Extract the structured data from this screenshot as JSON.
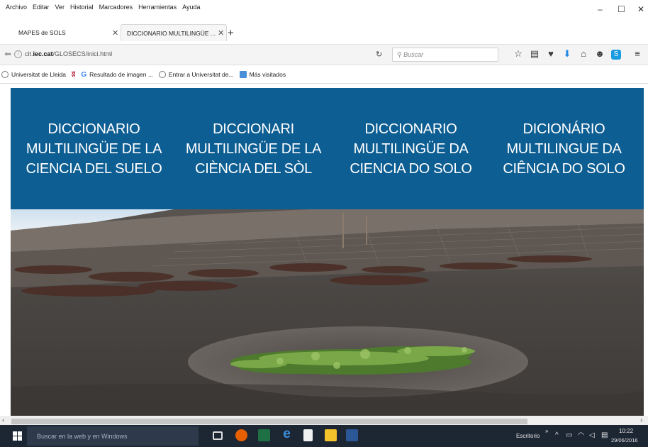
{
  "menubar": {
    "items": [
      "Archivo",
      "Editar",
      "Ver",
      "Historial",
      "Marcadores",
      "Herramientas",
      "Ayuda"
    ]
  },
  "window_controls": [
    "–",
    "☐",
    "✕"
  ],
  "tabs": [
    {
      "label": "MAPES de SOLS",
      "active": false
    },
    {
      "label": "DICCIONARIO MULTILINGÜE ...",
      "active": true
    }
  ],
  "navbar": {
    "url_prefix": "cit.",
    "url_host": "iec.cat",
    "url_path": "/GLOSECS/inici.html",
    "search_placeholder": "Buscar"
  },
  "bookmarks": [
    {
      "label": "Universitat de Lleida",
      "icon": "globe-icon",
      "color": "#7a7a7a"
    },
    {
      "label": "",
      "icon": "pocket-icon",
      "color": "#b1122b"
    },
    {
      "label": "Resultado de imagen ...",
      "icon": "google-icon",
      "color": "#4285f4"
    },
    {
      "label": "Entrar a Universitat de...",
      "icon": "globe-icon",
      "color": "#7a7a7a"
    },
    {
      "label": "Más visitados",
      "icon": "folder-icon",
      "color": "#4a90d9"
    }
  ],
  "page": {
    "banner_color": "#0d5e93",
    "titles": [
      {
        "line1": "DICCIONARIO",
        "line2": "MULTILINGÜE DE LA",
        "line3": "CIENCIA DEL SUELO"
      },
      {
        "line1": "DICCIONARI",
        "line2": "MULTILINGÜE DE LA",
        "line3": "CIÈNCIA DEL SÒL"
      },
      {
        "line1": "DICCIONARIO",
        "line2": "MULTILINGÜE DA",
        "line3": "CIENCIA DO SOLO"
      },
      {
        "line1": "DICIONÁRIO",
        "line2": "MULTILINGUE DA",
        "line3": "CIÊNCIA DO SOLO"
      }
    ]
  },
  "taskbar": {
    "search_placeholder": "Buscar en la web y en Windows",
    "desktop_label": "Escritorio",
    "time": "10:22",
    "date": "29/06/2016"
  }
}
